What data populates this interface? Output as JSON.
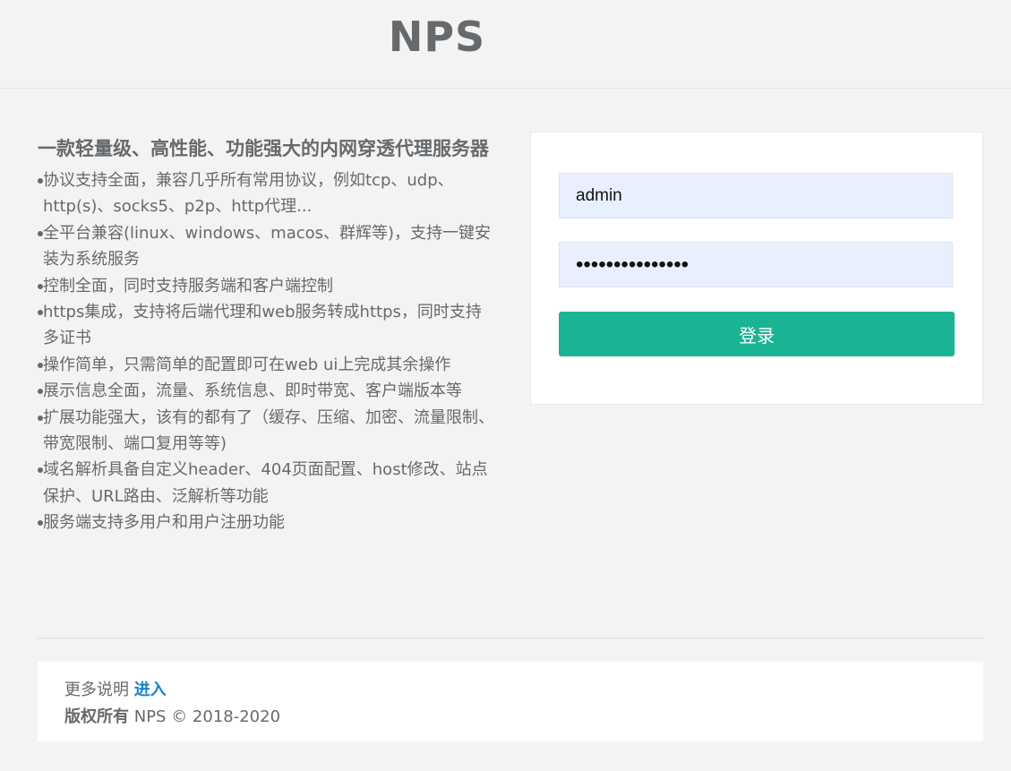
{
  "header": {
    "logo": "NPS"
  },
  "intro": {
    "title": "一款轻量级、高性能、功能强大的内网穿透代理服务器",
    "features": [
      "协议支持全面，兼容几乎所有常用协议，例如tcp、udp、http(s)、socks5、p2p、http代理...",
      "全平台兼容(linux、windows、macos、群辉等)，支持一键安装为系统服务",
      "控制全面，同时支持服务端和客户端控制",
      "https集成，支持将后端代理和web服务转成https，同时支持多证书",
      "操作简单，只需简单的配置即可在web ui上完成其余操作",
      "展示信息全面，流量、系统信息、即时带宽、客户端版本等",
      "扩展功能强大，该有的都有了（缓存、压缩、加密、流量限制、带宽限制、端口复用等等)",
      "域名解析具备自定义header、404页面配置、host修改、站点保护、URL路由、泛解析等功能",
      "服务端支持多用户和用户注册功能"
    ]
  },
  "login": {
    "username_value": "admin",
    "password_value": "•••••••••••••••",
    "submit_label": "登录"
  },
  "footer": {
    "more_text": "更多说明",
    "more_link": "进入",
    "copyright_label": "版权所有",
    "copyright_text": "NPS © 2018-2020"
  }
}
